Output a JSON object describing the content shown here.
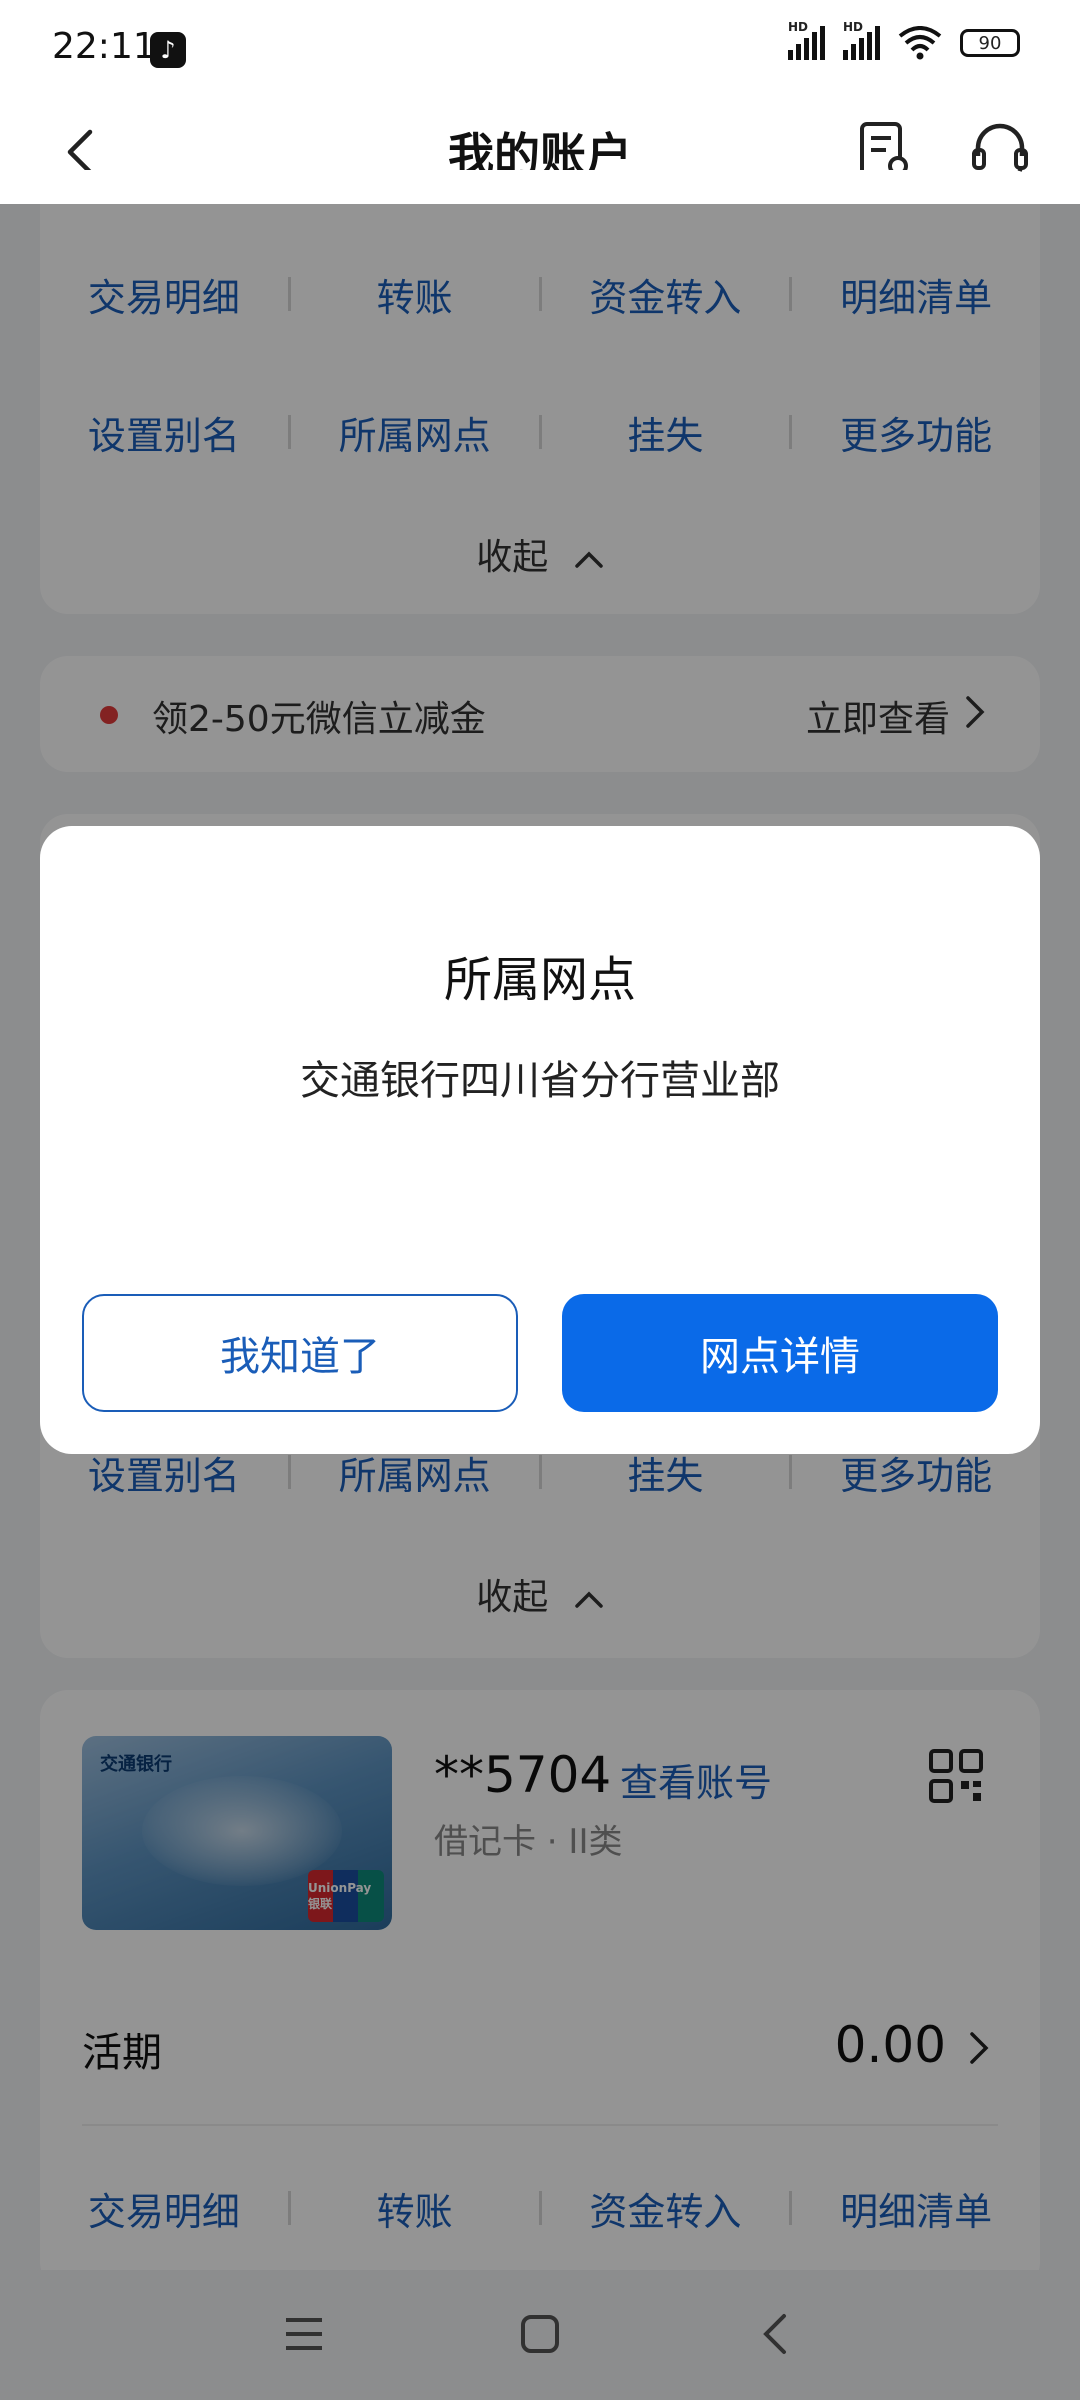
{
  "status_bar": {
    "time": "22:11",
    "tiktok_glyph": "♪",
    "hd1": "HD",
    "hd2": "HD",
    "battery": "90"
  },
  "nav": {
    "title": "我的账户"
  },
  "top_card": {
    "row1": [
      "交易明细",
      "转账",
      "资金转入",
      "明细清单"
    ],
    "row2": [
      "设置别名",
      "所属网点",
      "挂失",
      "更多功能"
    ],
    "collapse_label": "收起"
  },
  "promo": {
    "text": "领2-50元微信立减金",
    "link": "立即查看"
  },
  "mid_card": {
    "row2": [
      "设置别名",
      "所属网点",
      "挂失",
      "更多功能"
    ],
    "collapse_label": "收起"
  },
  "account_card": {
    "card_bank_name": "交通银行",
    "unionpay": "UnionPay 银联",
    "number": "**5704",
    "view_number": "查看账号",
    "type": "借记卡 · II类",
    "deposit_label": "活期",
    "balance": "0.00",
    "actions": [
      "交易明细",
      "转账",
      "资金转入",
      "明细清单"
    ]
  },
  "dialog": {
    "title": "所属网点",
    "body": "交通银行四川省分行营业部",
    "ok_button": "我知道了",
    "detail_button": "网点详情"
  },
  "colors": {
    "link": "#1a5db8",
    "primary_button": "#0a6ae8",
    "promo_dot": "#e23b3b"
  },
  "icons": [
    "back-icon",
    "statement-icon",
    "customer-service-icon",
    "chevron-up-icon",
    "chevron-right-icon",
    "qr-code-icon",
    "menu-icon",
    "home-icon",
    "nav-back-icon"
  ]
}
